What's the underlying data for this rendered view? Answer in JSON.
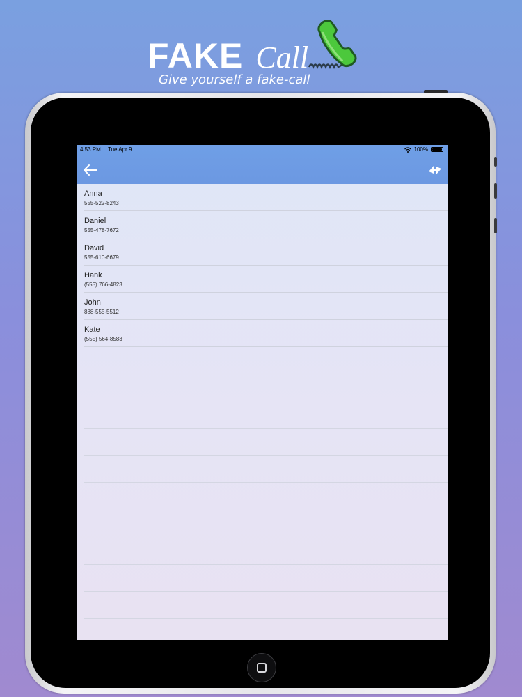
{
  "promo": {
    "title_fake": "FAKE",
    "title_call": "Call",
    "tagline": "Give yourself a fake-call",
    "logo_icon": "phone-handset-icon",
    "logo_color": "#4cc83c"
  },
  "status_bar": {
    "time": "4:53 PM",
    "date": "Tue Apr 9",
    "battery": "100%"
  },
  "nav": {
    "back_icon": "arrow-left-icon",
    "action_icon": "swap-arrows-icon",
    "bar_color": "#6c98e2"
  },
  "contacts": [
    {
      "name": "Anna",
      "phone": "555-522-8243"
    },
    {
      "name": "Daniel",
      "phone": "555-478-7672"
    },
    {
      "name": "David",
      "phone": "555-610-6679"
    },
    {
      "name": "Hank",
      "phone": "(555) 766-4823"
    },
    {
      "name": "John",
      "phone": "888-555-5512"
    },
    {
      "name": "Kate",
      "phone": "(555) 564-8583"
    }
  ]
}
